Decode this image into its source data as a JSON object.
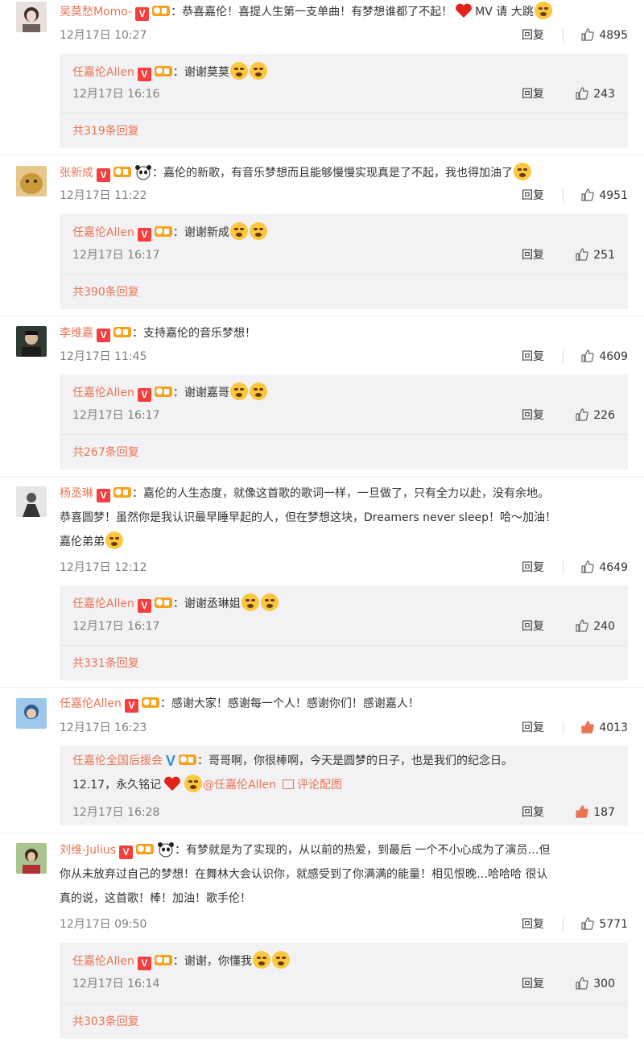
{
  "reply_label": "回复",
  "comments": [
    {
      "user": "吴莫愁Momo-",
      "text": "：恭喜嘉伦！喜提人生第一支单曲！有梦想谁都了不起！",
      "text_tail": "MV 请 大跳",
      "time": "12月17日 10:27",
      "likes": "4895",
      "reply": {
        "user": "任嘉伦Allen",
        "text": "：谢谢莫莫",
        "time": "12月17日 16:16",
        "likes": "243"
      },
      "more": "共319条回复",
      "avatar_color": "#d9cfc8"
    },
    {
      "user": "张新成",
      "text": "：嘉伦的新歌，有音乐梦想而且能够慢慢实现真是了不起，我也得加油了",
      "time": "12月17日 11:22",
      "likes": "4951",
      "reply": {
        "user": "任嘉伦Allen",
        "text": "：谢谢新成",
        "time": "12月17日 16:17",
        "likes": "251"
      },
      "more": "共390条回复",
      "avatar_color": "#c99a3c"
    },
    {
      "user": "李维嘉",
      "text": "：支持嘉伦的音乐梦想！",
      "time": "12月17日 11:45",
      "likes": "4609",
      "reply": {
        "user": "任嘉伦Allen",
        "text": "：谢谢嘉哥",
        "time": "12月17日 16:17",
        "likes": "226"
      },
      "more": "共267条回复",
      "avatar_color": "#3d4a3f"
    },
    {
      "user": "杨丞琳",
      "text_lines": [
        "：嘉伦的人生态度，就像这首歌的歌词一样，一旦做了，只有全力以赴，没有余地。",
        "恭喜圆梦！虽然你是我认识最早睡早起的人，但在梦想这块，Dreamers never sleep！哈～加油！",
        "嘉伦弟弟"
      ],
      "time": "12月17日 12:12",
      "likes": "4649",
      "reply": {
        "user": "任嘉伦Allen",
        "text": "：谢谢丞琳姐",
        "time": "12月17日 16:17",
        "likes": "240"
      },
      "more": "共331条回复",
      "avatar_color": "#8c8c8c"
    },
    {
      "user": "任嘉伦Allen",
      "text": "：感谢大家！感谢每一个人！感谢你们！感谢嘉人！",
      "time": "12月17日 16:23",
      "likes": "4013",
      "reply": {
        "user": "任嘉伦全国后援会",
        "text": "：哥哥啊，你很棒啊，今天是圆梦的日子，也是我们的纪念日。",
        "text2": "12.17，永久铭记",
        "mention": "@任嘉伦Allen",
        "pic_label": "评论配图",
        "time": "12月17日 16:28",
        "likes": "187"
      },
      "avatar_color": "#2f5c8a"
    },
    {
      "user": "刘维-Julius",
      "text_lines": [
        "：有梦就是为了实现的，从以前的热爱，到最后 一个不小心成为了演员…但",
        "你从未放弃过自己的梦想！在舞林大会认识你，就感受到了你满满的能量！相见恨晚…哈哈哈 很认",
        "真的说，这首歌！棒！加油！歌手伦！"
      ],
      "time": "12月17日 09:50",
      "likes": "5771",
      "reply": {
        "user": "任嘉伦Allen",
        "text": "：谢谢，你懂我",
        "time": "12月17日 16:14",
        "likes": "300"
      },
      "more": "共303条回复",
      "avatar_color": "#6e8f5a"
    }
  ],
  "icons": {
    "like": "thumbs-up-icon",
    "verified": "verified-v-icon",
    "level": "level-badge-icon",
    "emoji": "crying-emoji-icon",
    "panda": "panda-icon",
    "heart": "heart-icon"
  },
  "colors": {
    "username": "#eb7350",
    "verified_red": "#f43f3f",
    "verified_blue": "#2d8fe2",
    "reply_bg": "#f2f2f5",
    "liked": "#eb7350"
  }
}
